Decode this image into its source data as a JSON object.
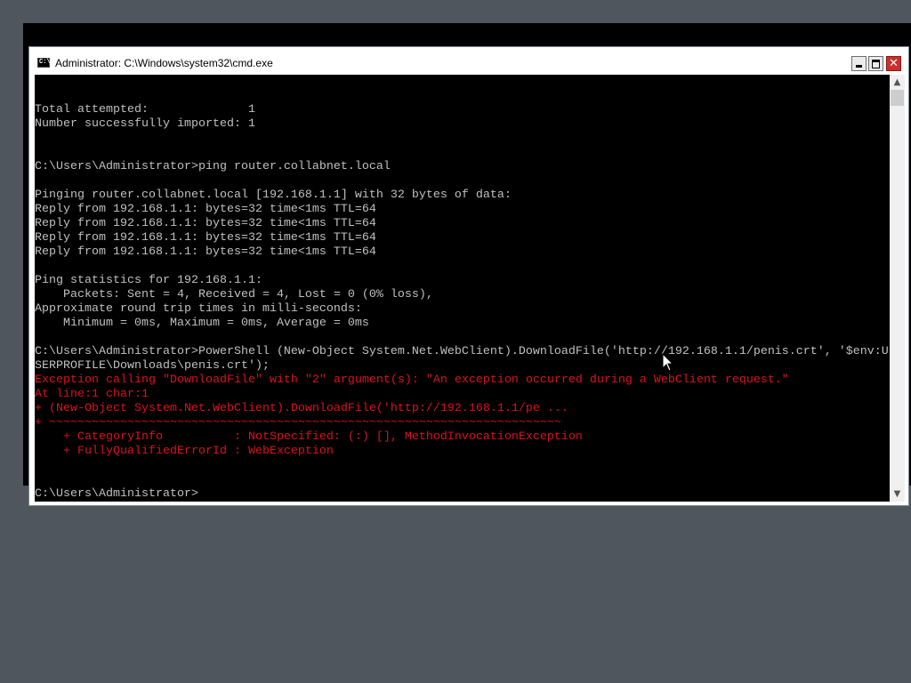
{
  "window": {
    "title": "Administrator: C:\\Windows\\system32\\cmd.exe",
    "icon_label": "C:\\",
    "minimize_symbol": "—",
    "maximize_symbol": "□",
    "close_symbol": "✕"
  },
  "console": {
    "lines": [
      {
        "text": "",
        "color": "normal"
      },
      {
        "text": "",
        "color": "normal"
      },
      {
        "text": "Total attempted:              1",
        "color": "normal"
      },
      {
        "text": "Number successfully imported: 1",
        "color": "normal"
      },
      {
        "text": "",
        "color": "normal"
      },
      {
        "text": "",
        "color": "normal"
      },
      {
        "text": "C:\\Users\\Administrator>ping router.collabnet.local",
        "color": "normal"
      },
      {
        "text": "",
        "color": "normal"
      },
      {
        "text": "Pinging router.collabnet.local [192.168.1.1] with 32 bytes of data:",
        "color": "normal"
      },
      {
        "text": "Reply from 192.168.1.1: bytes=32 time<1ms TTL=64",
        "color": "normal"
      },
      {
        "text": "Reply from 192.168.1.1: bytes=32 time<1ms TTL=64",
        "color": "normal"
      },
      {
        "text": "Reply from 192.168.1.1: bytes=32 time<1ms TTL=64",
        "color": "normal"
      },
      {
        "text": "Reply from 192.168.1.1: bytes=32 time<1ms TTL=64",
        "color": "normal"
      },
      {
        "text": "",
        "color": "normal"
      },
      {
        "text": "Ping statistics for 192.168.1.1:",
        "color": "normal"
      },
      {
        "text": "    Packets: Sent = 4, Received = 4, Lost = 0 (0% loss),",
        "color": "normal"
      },
      {
        "text": "Approximate round trip times in milli-seconds:",
        "color": "normal"
      },
      {
        "text": "    Minimum = 0ms, Maximum = 0ms, Average = 0ms",
        "color": "normal"
      },
      {
        "text": "",
        "color": "normal"
      },
      {
        "text": "C:\\Users\\Administrator>PowerShell (New-Object System.Net.WebClient).DownloadFile('http://192.168.1.1/penis.crt', '$env:U",
        "color": "normal"
      },
      {
        "text": "SERPROFILE\\Downloads\\penis.crt');",
        "color": "normal"
      },
      {
        "text": "Exception calling \"DownloadFile\" with \"2\" argument(s): \"An exception occurred during a WebClient request.\"",
        "color": "error"
      },
      {
        "text": "At line:1 char:1",
        "color": "error"
      },
      {
        "text": "+ (New-Object System.Net.WebClient).DownloadFile('http://192.168.1.1/pe ...",
        "color": "error"
      },
      {
        "text": "+ ~~~~~~~~~~~~~~~~~~~~~~~~~~~~~~~~~~~~~~~~~~~~~~~~~~~~~~~~~~~~~~~~~~~~~~~~",
        "color": "error"
      },
      {
        "text": "    + CategoryInfo          : NotSpecified: (:) [], MethodInvocationException",
        "color": "error"
      },
      {
        "text": "    + FullyQualifiedErrorId : WebException",
        "color": "error"
      },
      {
        "text": "",
        "color": "normal"
      },
      {
        "text": "",
        "color": "normal"
      },
      {
        "text": "C:\\Users\\Administrator>",
        "color": "normal"
      }
    ]
  },
  "scrollbar": {
    "up_arrow": "▲",
    "down_arrow": "▼"
  },
  "colors": {
    "console_bg": "#000000",
    "console_text": "#c0c0c0",
    "error_text": "#e0101a",
    "desktop": "#4f565d"
  }
}
